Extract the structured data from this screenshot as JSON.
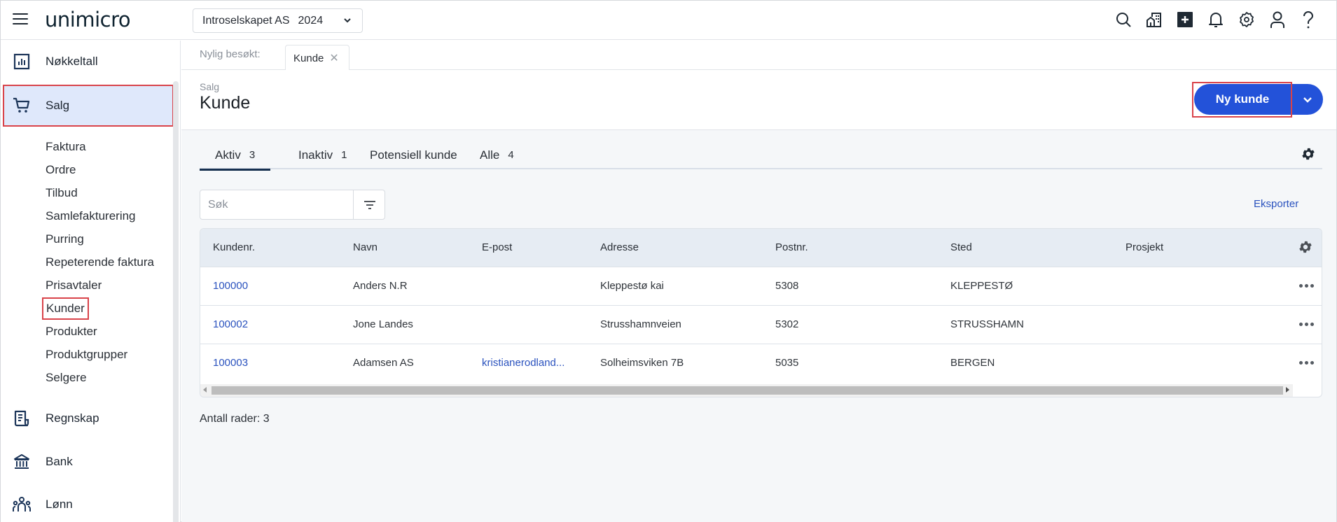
{
  "app": {
    "logo": "unimicro",
    "company": "Introselskapet AS",
    "year": "2024"
  },
  "topbar_icons": [
    "search-icon",
    "company-building-icon",
    "add-icon",
    "bell-icon",
    "settings-icon",
    "user-icon",
    "help-icon"
  ],
  "sidebar": {
    "main_items": [
      {
        "label": "Nøkkeltall",
        "icon": "chart-icon"
      },
      {
        "label": "Salg",
        "icon": "cart-icon",
        "active": true
      },
      {
        "label": "Regnskap",
        "icon": "ledger-icon"
      },
      {
        "label": "Bank",
        "icon": "bank-icon"
      },
      {
        "label": "Lønn",
        "icon": "people-icon"
      }
    ],
    "sub_items": [
      {
        "label": "Faktura"
      },
      {
        "label": "Ordre"
      },
      {
        "label": "Tilbud"
      },
      {
        "label": "Samlefakturering"
      },
      {
        "label": "Purring"
      },
      {
        "label": "Repeterende faktura"
      },
      {
        "label": "Prisavtaler"
      },
      {
        "label": "Kunder",
        "highlighted": true
      },
      {
        "label": "Produkter"
      },
      {
        "label": "Produktgrupper"
      },
      {
        "label": "Selgere"
      }
    ]
  },
  "recent": {
    "label": "Nylig besøkt:",
    "tabs": [
      {
        "label": "Kunde",
        "close": "✕"
      }
    ]
  },
  "header": {
    "breadcrumb": "Salg",
    "title": "Kunde",
    "new_button": "Ny kunde"
  },
  "tabs": [
    {
      "label": "Aktiv",
      "count": "3",
      "active": true
    },
    {
      "label": "Inaktiv",
      "count": "1"
    },
    {
      "label": "Potensiell kunde",
      "count": ""
    },
    {
      "label": "Alle",
      "count": "4"
    }
  ],
  "search": {
    "placeholder": "Søk",
    "value": ""
  },
  "export_label": "Eksporter",
  "table": {
    "columns": [
      "Kundenr.",
      "Navn",
      "E-post",
      "Adresse",
      "Postnr.",
      "Sted",
      "Prosjekt"
    ],
    "rows": [
      {
        "kundenr": "100000",
        "navn": "Anders N.R",
        "epost": "",
        "adresse": "Kleppestø kai",
        "postnr": "5308",
        "sted": "KLEPPESTØ",
        "prosjekt": ""
      },
      {
        "kundenr": "100002",
        "navn": "Jone Landes",
        "epost": "",
        "adresse": "Strusshamnveien",
        "postnr": "5302",
        "sted": "STRUSSHAMN",
        "prosjekt": ""
      },
      {
        "kundenr": "100003",
        "navn": "Adamsen AS",
        "epost": "kristianerodland...",
        "adresse": "Solheimsviken 7B",
        "postnr": "5035",
        "sted": "BERGEN",
        "prosjekt": ""
      }
    ]
  },
  "footer": {
    "row_count": "Antall rader: 3"
  },
  "colors": {
    "primary": "#2352d9",
    "link": "#2a52be",
    "active_nav_bg": "#dfe8fb",
    "highlight_outline": "#d9434a"
  }
}
